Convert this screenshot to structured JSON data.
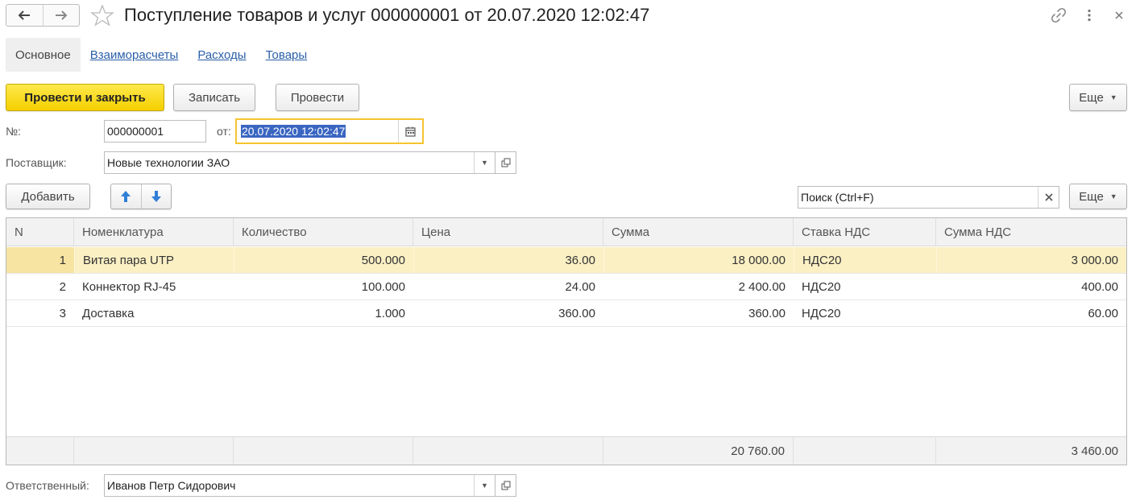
{
  "window": {
    "title": "Поступление товаров и услуг 000000001 от 20.07.2020 12:02:47"
  },
  "tabs": [
    {
      "label": "Основное"
    },
    {
      "label": "Взаиморасчеты"
    },
    {
      "label": "Расходы"
    },
    {
      "label": "Товары"
    }
  ],
  "toolbar": {
    "post_close_label": "Провести и закрыть",
    "save_label": "Записать",
    "post_label": "Провести",
    "more_label": "Еще"
  },
  "form": {
    "number_label": "№:",
    "number_value": "000000001",
    "date_label": "от:",
    "date_value": "20.07.2020 12:02:47",
    "supplier_label": "Поставщик:",
    "supplier_value": "Новые технологии ЗАО",
    "responsible_label": "Ответственный:",
    "responsible_value": "Иванов Петр Сидорович"
  },
  "table_toolbar": {
    "add_label": "Добавить",
    "search_placeholder": "Поиск (Ctrl+F)",
    "more_label": "Еще"
  },
  "table": {
    "columns": [
      "N",
      "Номенклатура",
      "Количество",
      "Цена",
      "Сумма",
      "Ставка НДС",
      "Сумма НДС"
    ],
    "rows": [
      {
        "n": "1",
        "item": "Витая пара UTP",
        "qty": "500.000",
        "price": "36.00",
        "sum": "18 000.00",
        "vat_rate": "НДС20",
        "vat_sum": "3 000.00"
      },
      {
        "n": "2",
        "item": "Коннектор RJ-45",
        "qty": "100.000",
        "price": "24.00",
        "sum": "2 400.00",
        "vat_rate": "НДС20",
        "vat_sum": "400.00"
      },
      {
        "n": "3",
        "item": "Доставка",
        "qty": "1.000",
        "price": "360.00",
        "sum": "360.00",
        "vat_rate": "НДС20",
        "vat_sum": "60.00"
      }
    ],
    "selected_row": 0,
    "totals": {
      "sum": "20 760.00",
      "vat_sum": "3 460.00"
    }
  },
  "icons": [
    "back-arrow-icon",
    "forward-arrow-icon",
    "star-icon",
    "link-icon",
    "more-vertical-icon",
    "close-icon",
    "calendar-icon",
    "open-form-icon",
    "arrow-up-icon",
    "arrow-down-icon",
    "clear-icon"
  ],
  "colors": {
    "accent_yellow": "#f4cf00",
    "link_blue": "#2a5fa8",
    "selection_row": "#fbf0c4",
    "date_focus": "#f4c430",
    "text_selection": "#3a66c2"
  }
}
